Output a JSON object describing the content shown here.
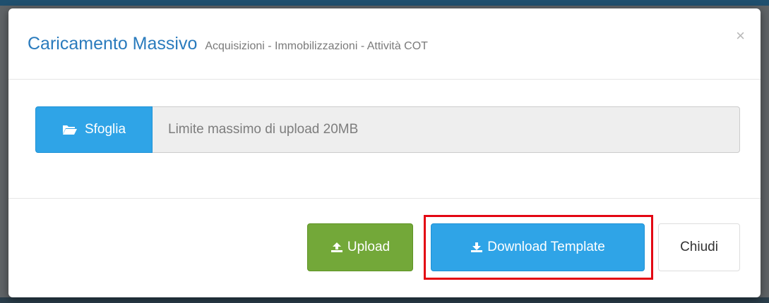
{
  "modal": {
    "title": "Caricamento Massivo",
    "subtitle": "Acquisizioni - Immobilizzazioni - Attività COT",
    "close_symbol": "×",
    "close_icon": "close-icon"
  },
  "file_input": {
    "browse_label": "Sfoglia",
    "browse_icon": "folder-open-icon",
    "placeholder": "Limite massimo di upload 20MB"
  },
  "footer": {
    "upload_label": "Upload",
    "upload_icon": "upload-icon",
    "download_label": "Download Template",
    "download_icon": "download-icon",
    "close_label": "Chiudi"
  },
  "colors": {
    "primary": "#2fa4e7",
    "success": "#73a839",
    "title": "#2a7bbd",
    "highlight": "#e30613"
  }
}
